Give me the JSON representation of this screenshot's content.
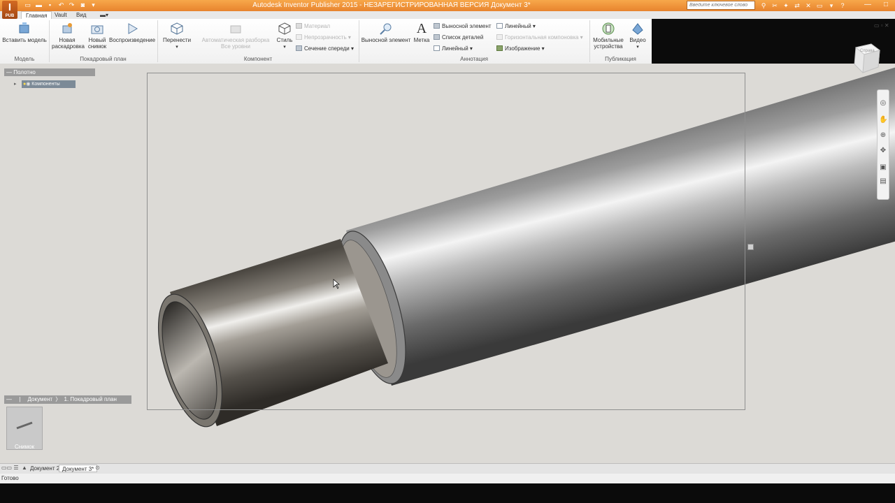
{
  "window": {
    "title": "Autodesk Inventor Publisher 2015 - НЕЗАРЕГИСТРИРОВАННАЯ ВЕРСИЯ    Документ 3*",
    "logo": "I",
    "logo_sub": "PUB",
    "search_placeholder": "Введите ключевое слово"
  },
  "menu_tabs": [
    {
      "label": "Главная",
      "active": true
    },
    {
      "label": "Vault",
      "active": false
    },
    {
      "label": "Вид",
      "active": false
    }
  ],
  "ribbon": {
    "model": {
      "label": "Модель",
      "insert_model": "Вставить модель"
    },
    "storyboard": {
      "label": "Покадровый план",
      "new_storyboard_1": "Новая",
      "new_storyboard_2": "раскадровка",
      "new_snapshot_1": "Новый",
      "new_snapshot_2": "снимок",
      "playback": "Воспроизведение"
    },
    "component": {
      "label": "Компонент",
      "move": "Перенести",
      "auto_explode_1": "Автоматическая разборка",
      "auto_explode_2": "Все уровни",
      "style": "Стиль",
      "material": "Материал",
      "opacity": "Непрозрачность",
      "front_section": "Сечение спереди"
    },
    "annotation": {
      "label": "Аннотация",
      "callout": "Выносной элемент",
      "tag": "Метка",
      "callout_small": "Выносной элемент",
      "parts_list": "Список деталей",
      "linear_1": "Линейный",
      "linear_2": "Линейный",
      "horizontal_layout": "Горизонтальная компоновка",
      "image": "Изображение"
    },
    "publish": {
      "label": "Публикация",
      "mobile_1": "Мобильные",
      "mobile_2": "устройства",
      "video": "Видео"
    }
  },
  "browser": {
    "header": "Полотно",
    "tree_item": "Компоненты"
  },
  "storyboard_bar": {
    "crumb_doc": "Документ",
    "crumb_plan": "1. Покадровый план"
  },
  "snapshot": {
    "label": "Снимок"
  },
  "view_cube": {
    "face_label": "Справа"
  },
  "doc_tabs": [
    {
      "label": "Документ 2*"
    },
    {
      "label": "Документ 3*"
    }
  ],
  "status": {
    "text": "Готово"
  },
  "colors": {
    "titlebar": "#e8832d",
    "selection": "#7c8a97",
    "viewport": "#dcdad6"
  }
}
